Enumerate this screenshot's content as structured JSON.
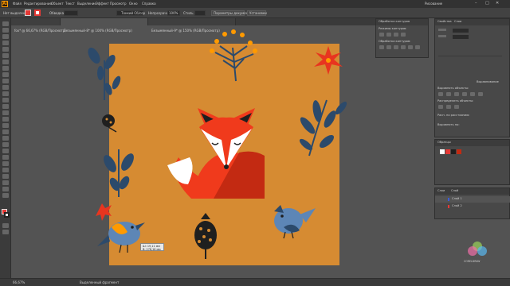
{
  "app": {
    "logo": "Ai"
  },
  "menu": {
    "items": [
      "Файл",
      "Редактирование",
      "Объект",
      "Текст",
      "Выделение",
      "Эффект",
      "Просмотр",
      "Окно",
      "Справка"
    ],
    "workspace": "Рисование"
  },
  "control_bar": {
    "no_selection": "Нет выделения",
    "stroke_label": "Обводка",
    "brush_label": "Тонкий Сб/сор",
    "opacity_label": "Непрозрачность",
    "opacity_value": "100%",
    "style_label": "Стиль",
    "doc_setup": "Параметры документа",
    "prefs": "Установки"
  },
  "tabs": [
    {
      "label": "fox* @ 66,67% (RGB/Просмотр)"
    },
    {
      "label": "Безымянный-8* @ 100% (RGB/Просмотр)"
    },
    {
      "label": "Безымянный-9* @ 150% (RGB/Просмотр)"
    }
  ],
  "panels": {
    "pathfinder": {
      "title": "Обработка контуров",
      "shape_modes": "Режимы контуров:",
      "pathfinders": "Обработка контуров:"
    },
    "properties": {
      "tabs": [
        "Свойства",
        "Слои",
        "Выравнивание"
      ],
      "align_objects": "Выровнять объекты:",
      "distribute_objects": "Распределить объекты:",
      "distribute_spacing": "Расп. по расстоянию:",
      "align_to": "Выровнять по:"
    },
    "swatches": {
      "title": "Образцы"
    },
    "layers": {
      "tabs": [
        "Слои",
        "Слой"
      ],
      "items": [
        {
          "name": "Слой 1",
          "color": "#3a5bd9"
        },
        {
          "name": "Слой 2",
          "color": "#e53935"
        }
      ]
    }
  },
  "status": {
    "zoom": "66,67%",
    "tool": "Выделенный фрагмент"
  },
  "tooltip": {
    "line1": "Ш: 19,11 мм",
    "line2": "В: 278,16 мм"
  },
  "watermark": {
    "text": "CORELDRAW"
  },
  "colors": {
    "artboard": "#d68b32",
    "fox": "#f03a1c",
    "leaves": "#2c4a6b",
    "bird": "#5d86b6",
    "dark": "#1f1f1f",
    "flower": "#e8351f",
    "accent": "#ff9a00"
  }
}
